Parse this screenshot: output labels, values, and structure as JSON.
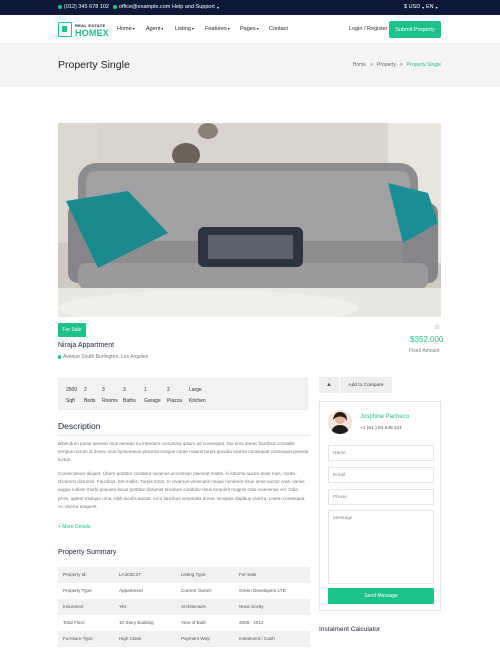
{
  "topbar": {
    "phone": "(012) 345 678 102",
    "email": "office@example.com",
    "help": "Help and Support",
    "currency": "$ USD",
    "language": "EN"
  },
  "nav": {
    "logo_top": "REAL ESTATE",
    "logo_bottom": "HOMEX",
    "menu": [
      "Home",
      "Agent",
      "Listing",
      "Features",
      "Pages",
      "Contact"
    ],
    "login": "Login / Register",
    "submit": "Submit Property"
  },
  "header": {
    "title": "Property Single",
    "breadcrumb": [
      "Home",
      ">",
      "Property",
      ">",
      "Property Single"
    ]
  },
  "property": {
    "badge": "For Sale",
    "name": "Niraja Appartment",
    "address": "Avenue South Burlington, Los Angeles",
    "price": "$352,000",
    "price_type": "Fixed Amount"
  },
  "features": [
    {
      "value": "2500",
      "label": "Sqft"
    },
    {
      "value": "2",
      "label": "Beds"
    },
    {
      "value": "3",
      "label": "Rooms"
    },
    {
      "value": "3",
      "label": "Baths"
    },
    {
      "value": "1",
      "label": "Garage"
    },
    {
      "value": "2",
      "label": "Piazza"
    },
    {
      "value": "Large",
      "label": "Kitchen"
    }
  ],
  "description": {
    "title": "Description",
    "para1": "Bibendum purus aenean mus aenean eu interdum nonummy ipsum ad consequat. Dui eros donec faucibus convallis tempus rutrum id donec mus hymenaeos placerat congue curae mauris turpis gravida viverra consequat consequat gravida luctus.",
    "para2": "Consectetuer aliquet. Libero porttitor curabitur vivamus accumsan placerat mattis, in lobortis auctor dolor mus, mattis. Dictumst dictumst. Faucibus. Est mollis. Turpis tortor. In vivamus venenatis neque hendrerit risus amet auctor cras, varius augue nullam morbi posuere lacus porttitor dictumst tincidunt curabitur risus torquent magnis cras maecenas vel. Odio proin, aptent tristique urna, nibh iaculis auctor. Arcu faucibus venenatis donec inceptos dapibus viverra. Lorem consequat. Ac viverra torquent.",
    "more": "+ More Details"
  },
  "summary": {
    "title": "Property Summary",
    "rows": [
      [
        "Property Id:",
        "LA403C27",
        "Listing Type:",
        "For Sale"
      ],
      [
        "Property Type:",
        "Appartment",
        "Current Owner:",
        "Green Developers LTD"
      ],
      [
        "Insurance:",
        "Yes",
        "Architecture:",
        "Nova Socity"
      ],
      [
        "Total Floor:",
        "10 Story Building",
        "Year of Built:",
        "2008 - 2012"
      ],
      [
        "Furniture Type:",
        "High Class",
        "Payment Way:",
        "Instalment / Cash"
      ]
    ]
  },
  "sidebar": {
    "compare": "Add to Compare",
    "agent_name": "Josphine Pacheco",
    "agent_phone": "+1 (81 ) 84 538 221",
    "name_placeholder": "Name",
    "email_placeholder": "Email",
    "phone_placeholder": "Phone",
    "message_placeholder": "Message",
    "send": "Send Message",
    "calculator_title": "Instalment Calculator"
  },
  "colors": {
    "accent": "#1ec28b",
    "dark": "#0d1836"
  }
}
